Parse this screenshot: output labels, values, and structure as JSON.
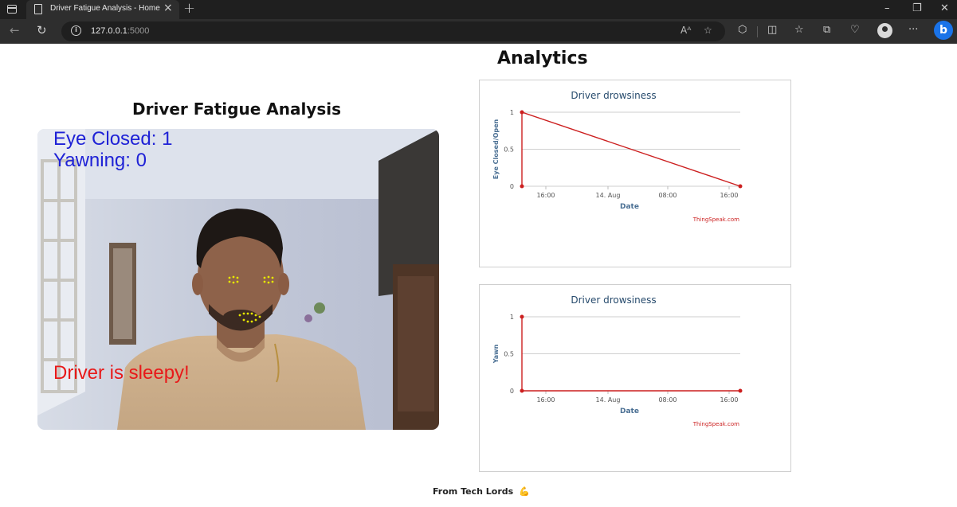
{
  "browser": {
    "tab_title": "Driver Fatigue Analysis - Home",
    "tab_close": "×",
    "new_tab": "+",
    "url_host": "127.0.0.1",
    "url_port": ":5000",
    "icons": [
      "window-icon",
      "back-icon",
      "reload-icon",
      "info-icon",
      "read-aloud-icon",
      "favorite-icon",
      "extensions-icon",
      "split-screen-icon",
      "favorites-icon",
      "collections-icon",
      "health-icon",
      "profile-icon",
      "more-icon",
      "bing-icon"
    ]
  },
  "page": {
    "analytics_title": "Analytics",
    "fatigue_title": "Driver Fatigue Analysis",
    "video": {
      "eye_closed": "Eye Closed: 1",
      "yawning": "Yawning: 0",
      "status": "Driver is sleepy!",
      "eye_text_color": "#1f22d6",
      "status_color": "#e81919"
    },
    "footer_text": "From Tech Lords",
    "footer_icon": "muscle-icon"
  },
  "chart_data": [
    {
      "type": "line",
      "title": "Driver drowsiness",
      "xlabel": "Date",
      "ylabel": "Eye Closed/Open",
      "credit": "ThingSpeak.com",
      "x_tick_labels": [
        "16:00",
        "14. Aug",
        "08:00",
        "16:00"
      ],
      "y_tick_labels": [
        "0",
        "0.5",
        "1"
      ],
      "ylim": [
        0,
        1
      ],
      "grid": true,
      "color": "#cc1f1f",
      "series": [
        {
          "points": [
            [
              0,
              0
            ],
            [
              0,
              1
            ],
            [
              1,
              0
            ]
          ]
        }
      ]
    },
    {
      "type": "line",
      "title": "Driver drowsiness",
      "xlabel": "Date",
      "ylabel": "Yawn",
      "credit": "ThingSpeak.com",
      "x_tick_labels": [
        "16:00",
        "14. Aug",
        "08:00",
        "16:00"
      ],
      "y_tick_labels": [
        "0",
        "0.5",
        "1"
      ],
      "ylim": [
        0,
        1
      ],
      "grid": true,
      "color": "#cc1f1f",
      "series": [
        {
          "points": [
            [
              0,
              1
            ],
            [
              0,
              0
            ],
            [
              1,
              0
            ]
          ]
        }
      ]
    }
  ]
}
